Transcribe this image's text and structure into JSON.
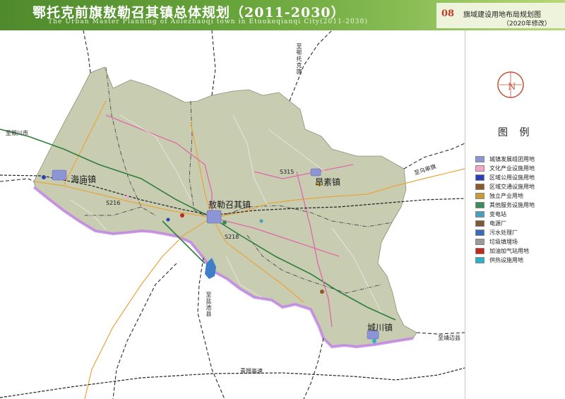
{
  "header": {
    "title": "鄂托克前旗敖勒召其镇总体规划（2011-2030）",
    "subtitle": "The Urban Master Planning of Aolezhaoqi town in Etuokeqianqi City(2011-2030)",
    "map_number": "08",
    "map_name": "旗域建设用地布局规划图",
    "revision": "（2020年修改）"
  },
  "map": {
    "places": {
      "haimiao": "海庙镇",
      "aolezhaoqi": "敖勒召其镇",
      "angsu": "昂素镇",
      "chengchuan": "城川镇"
    },
    "directions": {
      "yinchuan": "至银川市",
      "eqi": "至鄂托克旗",
      "wushen": "至乌审旗",
      "yanchi": "至盐池县",
      "jingbian": "至靖边县"
    },
    "roads": {
      "g307": "青银高速",
      "s216": "S216",
      "s218": "S218",
      "s315": "S315"
    },
    "colors": {
      "land": "#c8cdb2",
      "boundary": "#b86bd6",
      "highway": "#2f7d3c",
      "provincial": "#e8a53b",
      "planned": "#e06ca8",
      "railway": "#2a2a2a",
      "lake": "#3f7ec9"
    }
  },
  "legend": {
    "title": "图 例",
    "items": [
      {
        "label": "城镇发展组团用地",
        "color": "#8c95d6",
        "icon": "urban-cluster-icon"
      },
      {
        "label": "文化产业设施用地",
        "color": "#f2a6c8",
        "icon": "culture-icon"
      },
      {
        "label": "区域公用设施用地",
        "color": "#2a3fb8",
        "icon": "utility-icon"
      },
      {
        "label": "区域交通设施用地",
        "color": "#8a5a2c",
        "icon": "transport-icon"
      },
      {
        "label": "独立产业用地",
        "color": "#c79c38",
        "icon": "industry-icon"
      },
      {
        "label": "其他服务设施用地",
        "color": "#3b8c5a",
        "icon": "service-icon"
      },
      {
        "label": "变电站",
        "color": "#46a0b8",
        "icon": "substation-icon"
      },
      {
        "label": "电源厂",
        "color": "#7a5a3a",
        "icon": "power-plant-icon"
      },
      {
        "label": "污水处理厂",
        "color": "#3b6bb8",
        "icon": "sewage-icon"
      },
      {
        "label": "垃圾填埋场",
        "color": "#9a9a9a",
        "icon": "landfill-icon"
      },
      {
        "label": "加油加气站用地",
        "color": "#c0281e",
        "icon": "gas-station-icon"
      },
      {
        "label": "供热设施用地",
        "color": "#2ab0c8",
        "icon": "heating-icon"
      }
    ]
  }
}
